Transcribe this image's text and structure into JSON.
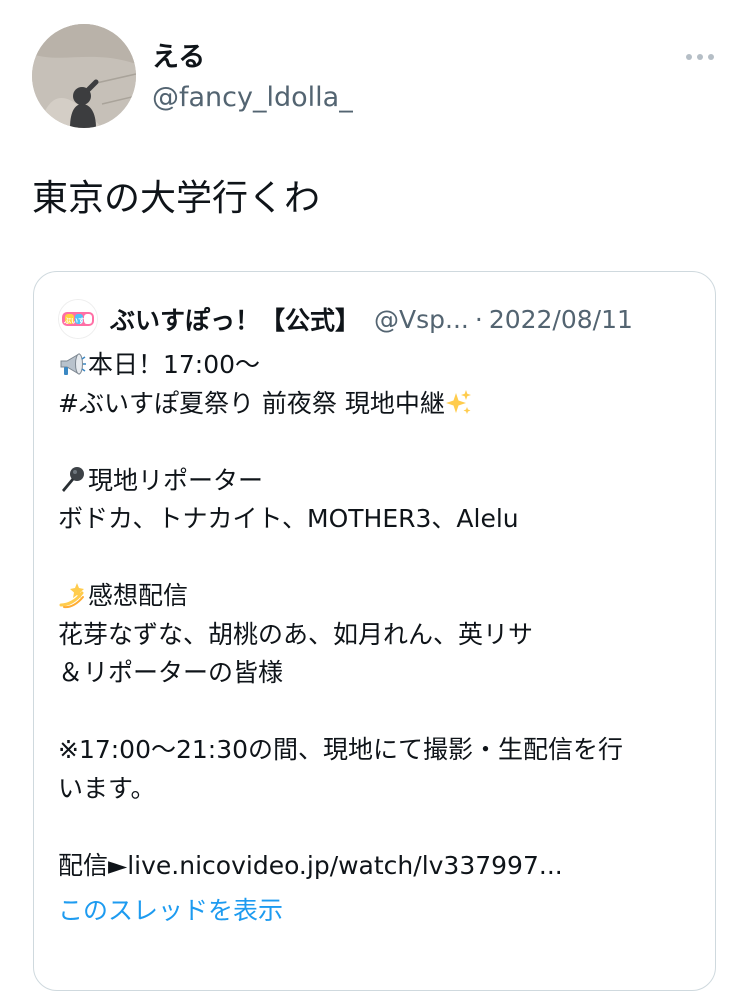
{
  "tweet": {
    "author": {
      "display_name": "える",
      "handle": "@fancy_ldolla_",
      "avatar_icon": "profile-photo-shadow"
    },
    "more_icon": "more-horizontal-icon",
    "text": "東京の大学行くわ"
  },
  "quoted_tweet": {
    "author": {
      "display_name": "ぶいすぽっ！【公式】",
      "handle": "@Vsp...",
      "avatar_icon": "vspo-logo",
      "avatar_logo_text": "ぶいすぽ"
    },
    "separator": "·",
    "date": "2022/08/11",
    "lines": {
      "l1": "本日！17:00～",
      "l2": "#ぶいすぽ夏祭り 前夜祭 現地中継",
      "l4": "現地リポーター",
      "l5": "ボドカ、トナカイト、MOTHER3、Alelu",
      "l7": "感想配信",
      "l8": "花芽なずな、胡桃のあ、如月れん、英リサ",
      "l9": "＆リポーターの皆様",
      "l11": "※17:00～21:30の間、現地にて撮影・生配信を行",
      "l12": "います。",
      "l14_prefix": "配信►",
      "l14_link": "live.nicovideo.jp/watch/lv337997..."
    },
    "emojis": {
      "megaphone": "megaphone-icon",
      "sparkles": "sparkles-icon",
      "microphone": "microphone-icon",
      "dizzy": "dizzy-star-icon"
    },
    "show_thread": "このスレッドを表示"
  },
  "colors": {
    "text_primary": "#0f1419",
    "text_secondary": "#536471",
    "link": "#1d9bf0",
    "border": "#cfd9de"
  }
}
